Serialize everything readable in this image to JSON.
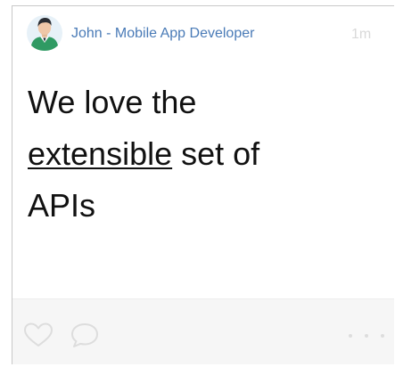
{
  "post": {
    "author": "John - Mobile App Developer",
    "time": "1m",
    "text_before": "We love the",
    "text_highlight": "extensible",
    "text_after": "set of",
    "text_end": "APIs"
  },
  "icons": {
    "avatar": "user-avatar",
    "like": "heart-icon",
    "comment": "comment-icon",
    "more": "more-icon"
  },
  "colors": {
    "author": "#4a7bb7",
    "muted": "#d9d9d9",
    "text": "#111111",
    "border": "#c8c8c8"
  }
}
